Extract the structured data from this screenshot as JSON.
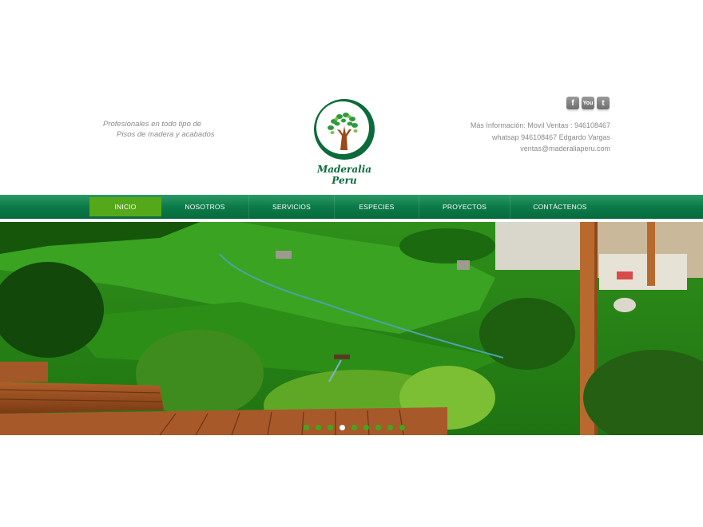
{
  "header": {
    "tagline_line1": "Profesionales en todo tipo de",
    "tagline_line2": "Pisos de madera y acabados",
    "logo_text_line1": "Maderalia",
    "logo_text_line2": "Peru",
    "social": [
      {
        "name": "facebook-icon",
        "glyph": "f"
      },
      {
        "name": "youtube-icon",
        "glyph": "You"
      },
      {
        "name": "twitter-icon",
        "glyph": "t"
      }
    ],
    "contact": {
      "line1": "Más Información: Movil Ventas : 946108467",
      "line2": "whatsap 946108467 Edgardo Vargas",
      "line3": "ventas@maderaliaperu.com"
    }
  },
  "nav": {
    "items": [
      {
        "label": "INICIO",
        "active": true
      },
      {
        "label": "NOSOTROS",
        "active": false
      },
      {
        "label": "SERVICIOS",
        "active": false
      },
      {
        "label": "ESPECIES",
        "active": false
      },
      {
        "label": "PROYECTOS",
        "active": false
      },
      {
        "label": "CONTÁCTENOS",
        "active": false
      }
    ]
  },
  "slider": {
    "slide_count": 9,
    "active_slide": 4
  },
  "colors": {
    "nav_green": "#0c7a48",
    "active_green": "#55a81a",
    "brand_green": "#0b6b3a"
  }
}
